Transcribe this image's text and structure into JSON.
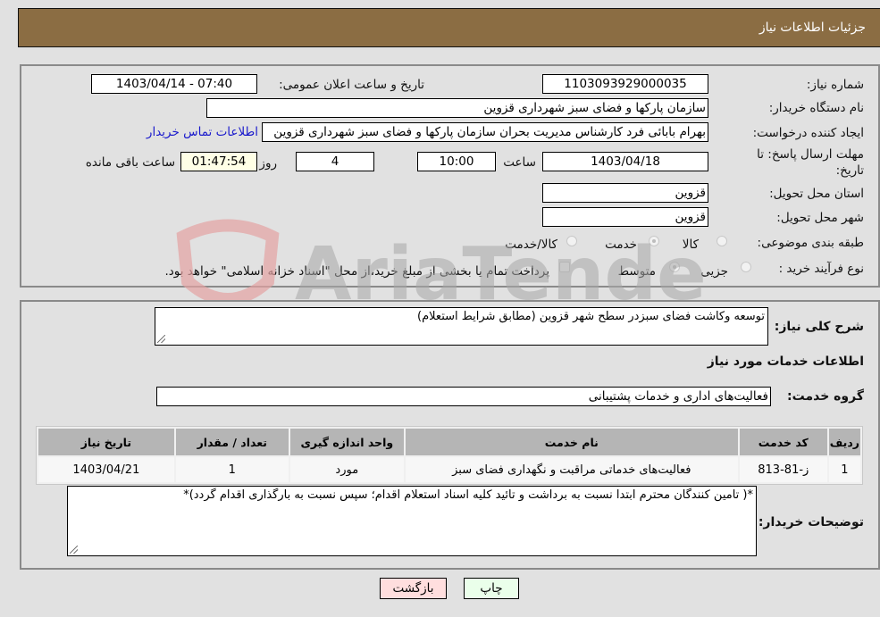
{
  "header": {
    "title": "جزئيات اطلاعات نياز"
  },
  "details": {
    "need_number_label": "شماره نیاز:",
    "need_number": "1103093929000035",
    "announce_label": "تاریخ و ساعت اعلان عمومی:",
    "announce_value": "1403/04/14 - 07:40",
    "buyer_org_label": "نام دستگاه خریدار:",
    "buyer_org": "سازمان پارکها و فضای سبز شهرداری قزوین",
    "creator_label": "ایجاد کننده درخواست:",
    "creator": "بهرام بابائی فرد کارشناس مدیریت بحران سازمان پارکها و فضای سبز شهرداری قزوین",
    "contact_link": "اطلاعات تماس خریدار",
    "deadline_label_line1": "مهلت ارسال پاسخ: تا",
    "deadline_label_line2": "تاریخ:",
    "deadline_date": "1403/04/18",
    "time_label": "ساعت",
    "deadline_time": "10:00",
    "days_value": "4",
    "days_label": "روز و",
    "remaining_time": "01:47:54",
    "remaining_label": "ساعت باقی مانده",
    "province_label": "استان محل تحویل:",
    "province": "قزوین",
    "city_label": "شهر محل تحویل:",
    "city": "قزوین",
    "category_label": "طبقه بندی موضوعی:",
    "category_options": [
      {
        "label": "کالا",
        "selected": false
      },
      {
        "label": "خدمت",
        "selected": true
      },
      {
        "label": "کالا/خدمت",
        "selected": false
      }
    ],
    "process_label": "نوع فرآیند خرید :",
    "process_options": [
      {
        "label": "جزیی",
        "selected": false
      },
      {
        "label": "متوسط",
        "selected": true
      }
    ],
    "treasury_checkbox_label": "پرداخت تمام یا بخشی از مبلغ خرید،از محل \"اسناد خزانه اسلامی\" خواهد بود.",
    "treasury_checked": false
  },
  "need": {
    "description_label": "شرح کلی نیاز:",
    "description": "توسعه وکاشت فضای سبزدر سطح شهر قزوین (مطابق شرایط استعلام)",
    "services_heading": "اطلاعات خدمات مورد نیاز",
    "service_group_label": "گروه خدمت:",
    "service_group": "فعالیت‌های اداری و خدمات پشتیبانی",
    "table": {
      "headers": [
        "ردیف",
        "کد خدمت",
        "نام خدمت",
        "واحد اندازه گیری",
        "تعداد / مقدار",
        "تاریخ نیاز"
      ],
      "rows": [
        [
          "1",
          "ز-81-813",
          "فعالیت‌های خدماتی مراقبت و نگهداری فضای سبز",
          "مورد",
          "1",
          "1403/04/21"
        ]
      ]
    },
    "buyer_notes_label": "توضیحات خریدار:",
    "buyer_notes": "*( تامین کنندگان محترم ابتدا نسبت به برداشت و تائید کلیه اسناد استعلام اقدام؛ سپس نسبت به بارگذاری اقدام گردد)*"
  },
  "buttons": {
    "print": "چاپ",
    "back": "بازگشت"
  },
  "colors": {
    "header": "#8b6d43",
    "print_bg": "#eaffea",
    "back_bg": "#ffdede",
    "link": "#1a1acc"
  },
  "watermark": {
    "text": "AriaTender.neT"
  }
}
